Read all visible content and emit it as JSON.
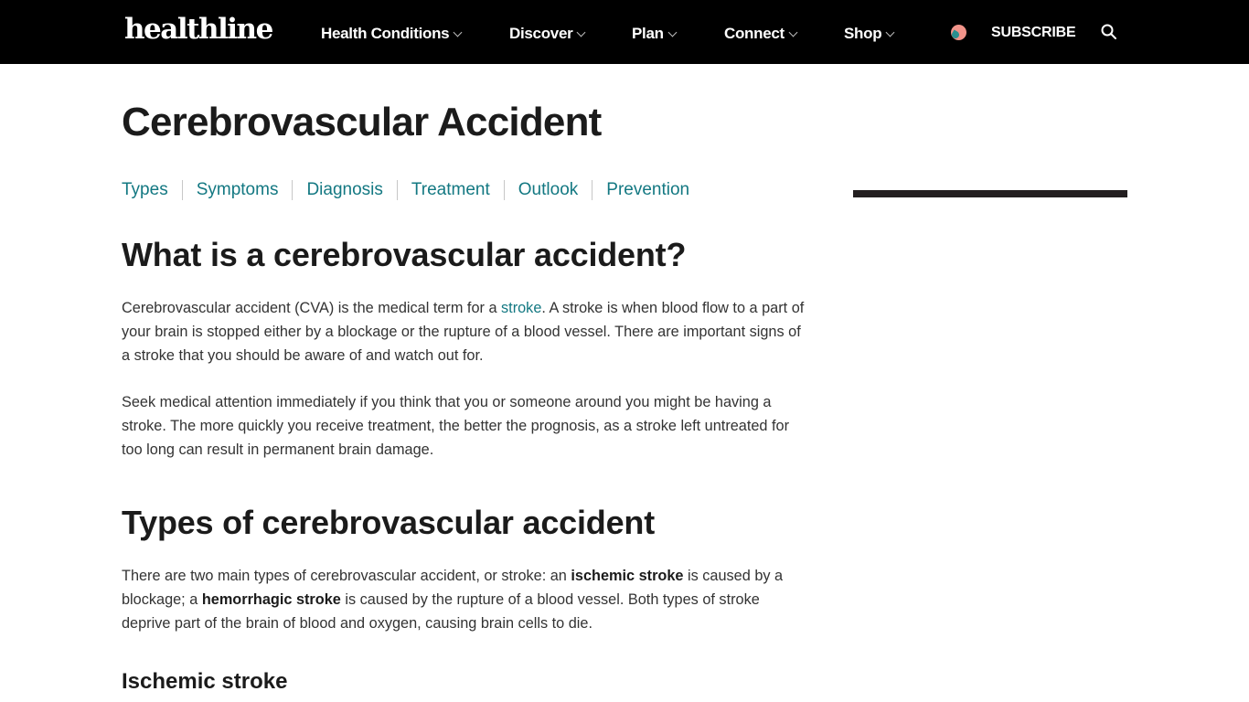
{
  "header": {
    "logo": "healthline",
    "nav": [
      {
        "label": "Health Conditions"
      },
      {
        "label": "Discover"
      },
      {
        "label": "Plan"
      },
      {
        "label": "Connect"
      },
      {
        "label": "Shop"
      }
    ],
    "subscribe_label": "SUBSCRIBE",
    "icons": {
      "search": "search-icon",
      "chevron": "chevron-down-icon",
      "avatar": "avatar-icon"
    }
  },
  "article": {
    "title": "Cerebrovascular Accident",
    "toc": [
      "Types",
      "Symptoms",
      "Diagnosis",
      "Treatment",
      "Outlook",
      "Prevention"
    ],
    "sections": [
      {
        "heading": "What is a cerebrovascular accident?",
        "p1_before": "Cerebrovascular accident (CVA) is the medical term for a ",
        "p1_link": "stroke",
        "p1_after": ". A stroke is when blood flow to a part of your brain is stopped either by a blockage or the rupture of a blood vessel. There are important signs of a stroke that you should be aware of and watch out for.",
        "p2": "Seek medical attention immediately if you think that you or someone around you might be having a stroke. The more quickly you receive treatment, the better the prognosis, as a stroke left untreated for too long can result in permanent brain damage."
      },
      {
        "heading": "Types of cerebrovascular accident",
        "p1_a": "There are two main types of cerebrovascular accident, or stroke: an ",
        "p1_b1": "ischemic stroke",
        "p1_c": " is caused by a blockage; a ",
        "p1_b2": "hemorrhagic stroke",
        "p1_d": " is caused by the rupture of a blood vessel. Both types of stroke deprive part of the brain of blood and oxygen, causing brain cells to die."
      }
    ],
    "subheading": "Ischemic stroke"
  }
}
